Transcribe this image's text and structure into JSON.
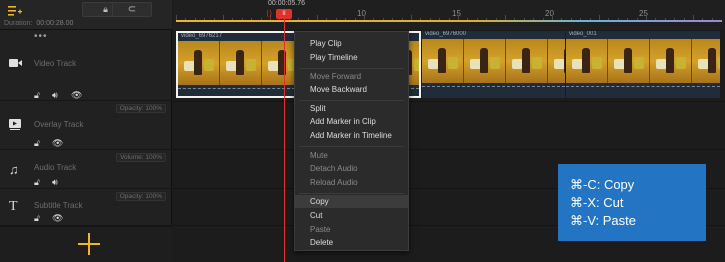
{
  "toolbar": {
    "duration_label": "Duration:",
    "duration_value": "00:00:28.00",
    "lock_icon": "lock-icon",
    "magnet_icon": "magnet-icon"
  },
  "ruler": {
    "ticks": [
      "10",
      "15",
      "20",
      "25"
    ],
    "playhead_time": "00:00:05.76",
    "playhead_flag": "II"
  },
  "tracks": {
    "video": {
      "name": "Video Track",
      "menu": "•••"
    },
    "overlay": {
      "name": "Overlay Track",
      "pill": "Opacity: 100%"
    },
    "audio": {
      "name": "Audio Track",
      "pill": "Volume: 100%"
    },
    "subtitle": {
      "name": "Subtitle Track",
      "pill": "Opacity: 100%",
      "icon_glyph": "T"
    }
  },
  "clips": [
    {
      "label": "video_6976217"
    },
    {
      "label": "video_6976000"
    },
    {
      "label": "video_001"
    }
  ],
  "context_menu": {
    "group1": [
      {
        "label": "Play Clip",
        "disabled": false
      },
      {
        "label": "Play Timeline",
        "disabled": false
      }
    ],
    "group2": [
      {
        "label": "Move Forward",
        "disabled": true
      },
      {
        "label": "Move Backward",
        "disabled": false
      }
    ],
    "group3": [
      {
        "label": "Split",
        "disabled": false
      },
      {
        "label": "Add Marker in Clip",
        "disabled": false
      },
      {
        "label": "Add Marker in Timeline",
        "disabled": false
      }
    ],
    "group4": [
      {
        "label": "Mute",
        "disabled": true
      },
      {
        "label": "Detach Audio",
        "disabled": true
      },
      {
        "label": "Reload Audio",
        "disabled": true
      }
    ],
    "group5": [
      {
        "label": "Copy",
        "disabled": false,
        "highlighted": true
      },
      {
        "label": "Cut",
        "disabled": false
      },
      {
        "label": "Paste",
        "disabled": true
      },
      {
        "label": "Delete",
        "disabled": false
      }
    ]
  },
  "callout": {
    "line1": "⌘-C: Copy",
    "line2": "⌘-X: Cut",
    "line3": "⌘-V: Paste"
  },
  "colors": {
    "accent": "#f0b62a",
    "playhead": "#e0322a",
    "callout_bg": "#2474c4"
  }
}
